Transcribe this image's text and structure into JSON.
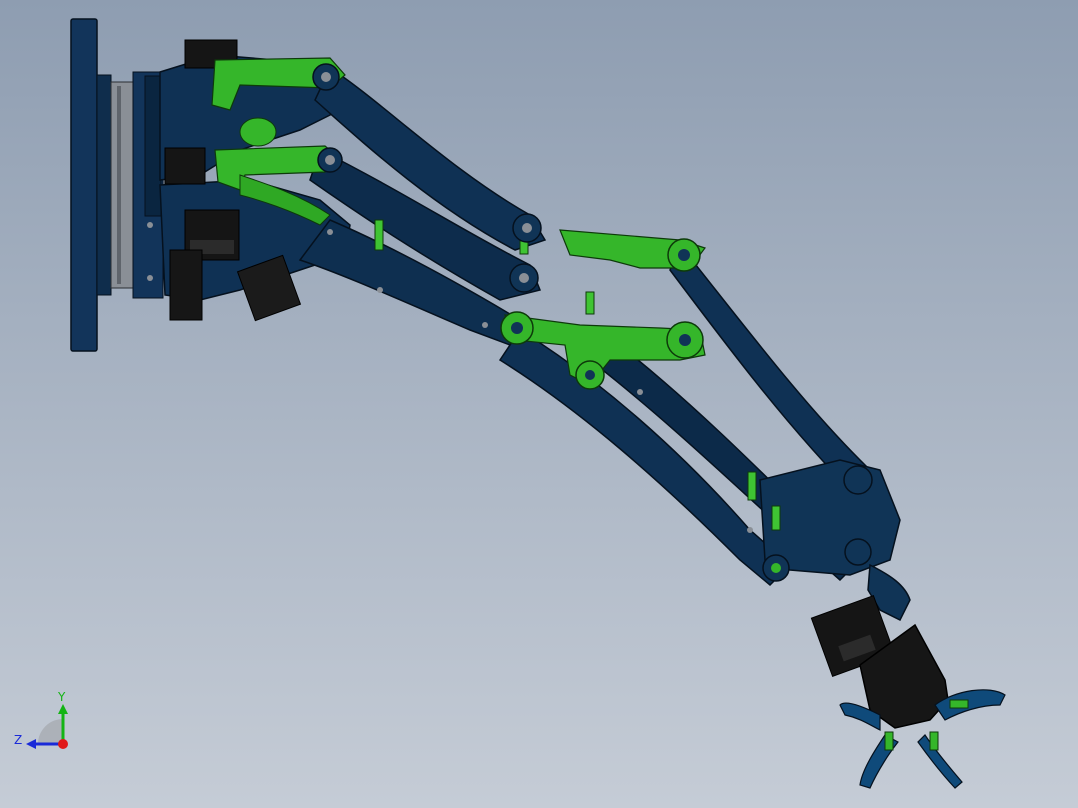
{
  "viewport": {
    "background_top": "#8e9db1",
    "background_bottom": "#c5ccd6"
  },
  "model": {
    "part_color": "#0e3050",
    "part_edge_color": "#05111e",
    "linkage_color": "#35b62a",
    "linkage_edge_color": "#0d3a0a",
    "servo_color": "#151515",
    "bearing_color": "#8a8f96"
  },
  "triad": {
    "y_label": "Y",
    "z_label": "Z",
    "y_color": "#14b414",
    "z_color": "#1a2ad8",
    "x_color": "#e01818"
  }
}
